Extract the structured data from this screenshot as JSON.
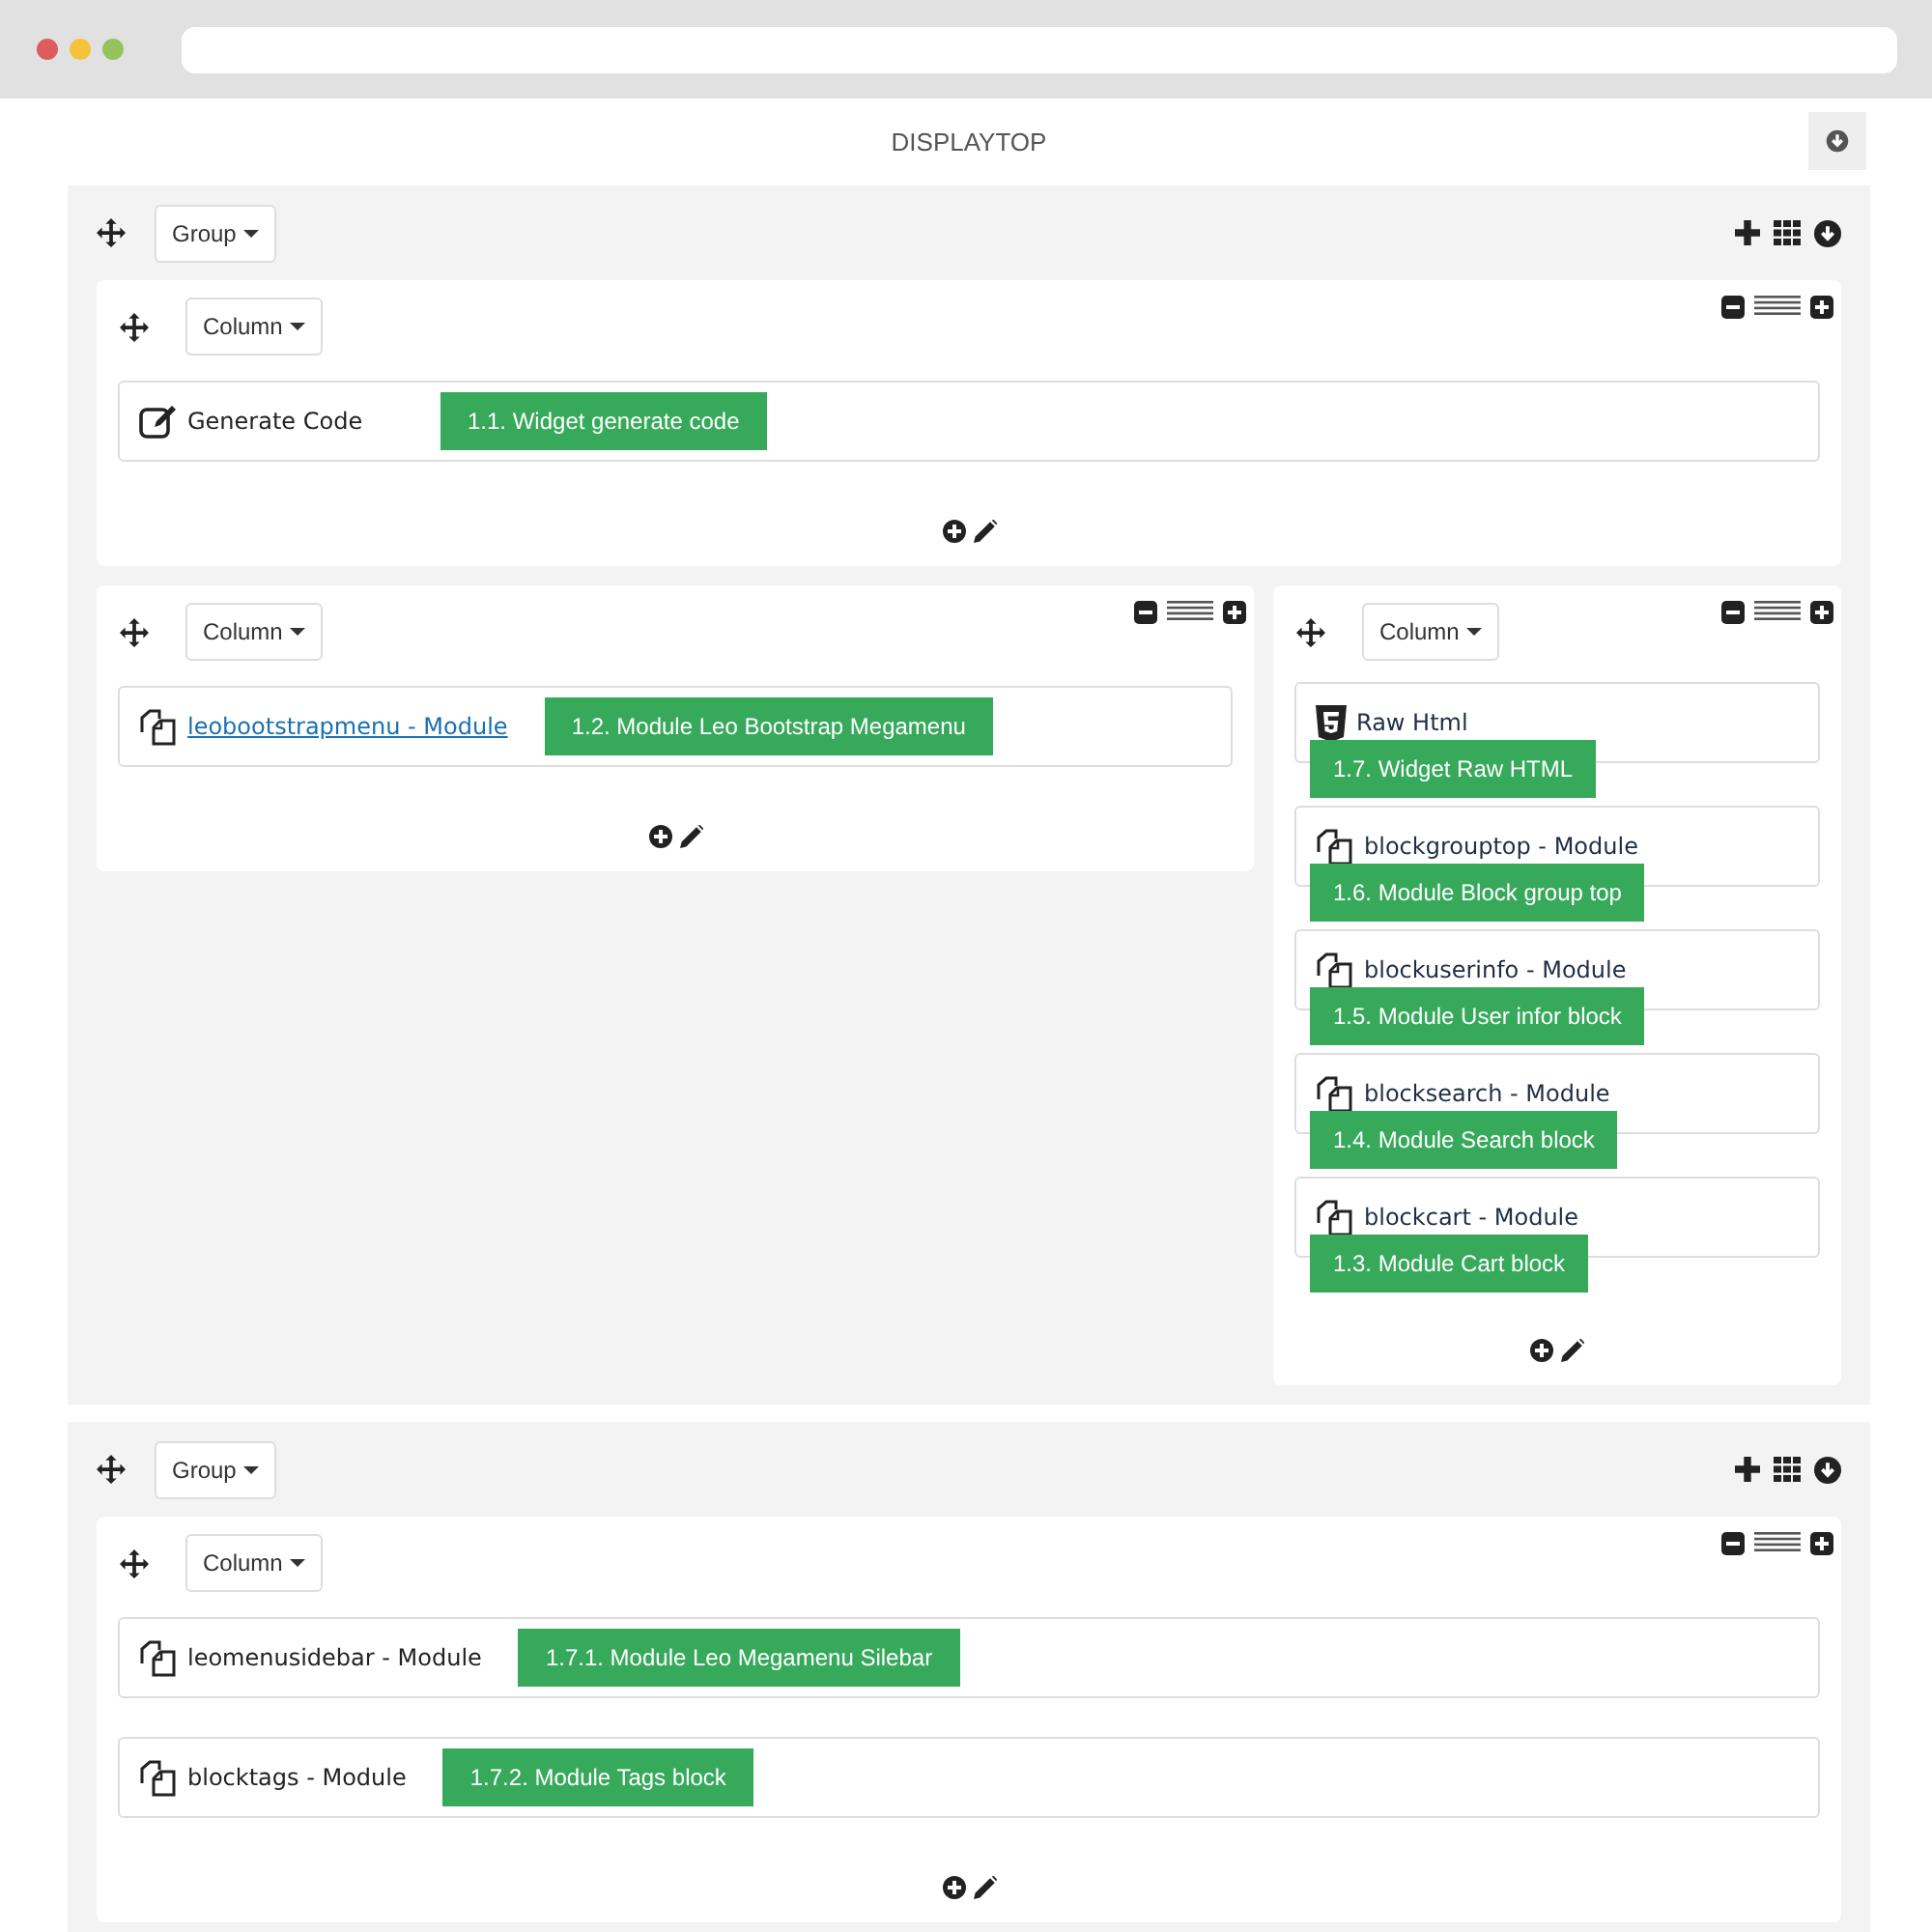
{
  "title": "DISPLAYTOP",
  "groups": [
    {
      "label": "Group",
      "rows": [
        {
          "columns": [
            {
              "label": "Column",
              "widgets": [
                {
                  "kind": "code",
                  "name": "Generate Code",
                  "link": false,
                  "tag": "1.1. Widget generate code"
                }
              ]
            }
          ]
        },
        {
          "columns": [
            {
              "label": "Column",
              "widgets": [
                {
                  "kind": "module",
                  "name": "leobootstrapmenu - Module",
                  "link": true,
                  "tag": "1.2. Module Leo Bootstrap Megamenu"
                }
              ]
            },
            {
              "label": "Column",
              "widgets": [
                {
                  "kind": "html",
                  "name": "Raw Html",
                  "link": false,
                  "tag": "1.7. Widget Raw HTML"
                },
                {
                  "kind": "module",
                  "name": "blockgrouptop - Module",
                  "link": false,
                  "tag": "1.6. Module Block group top"
                },
                {
                  "kind": "module",
                  "name": "blockuserinfo - Module",
                  "link": false,
                  "tag": "1.5. Module User infor block"
                },
                {
                  "kind": "module",
                  "name": "blocksearch - Module",
                  "link": false,
                  "tag": "1.4. Module Search block"
                },
                {
                  "kind": "module",
                  "name": "blockcart - Module",
                  "link": false,
                  "tag": "1.3. Module Cart block"
                }
              ]
            }
          ]
        }
      ]
    },
    {
      "label": "Group",
      "rows": [
        {
          "columns": [
            {
              "label": "Column",
              "widgets": [
                {
                  "kind": "module",
                  "name": "leomenusidebar - Module",
                  "link": false,
                  "tag": "1.7.1. Module Leo Megamenu Silebar"
                },
                {
                  "kind": "module",
                  "name": "blocktags - Module",
                  "link": false,
                  "tag": "1.7.2. Module Tags block"
                }
              ]
            }
          ]
        }
      ]
    }
  ]
}
